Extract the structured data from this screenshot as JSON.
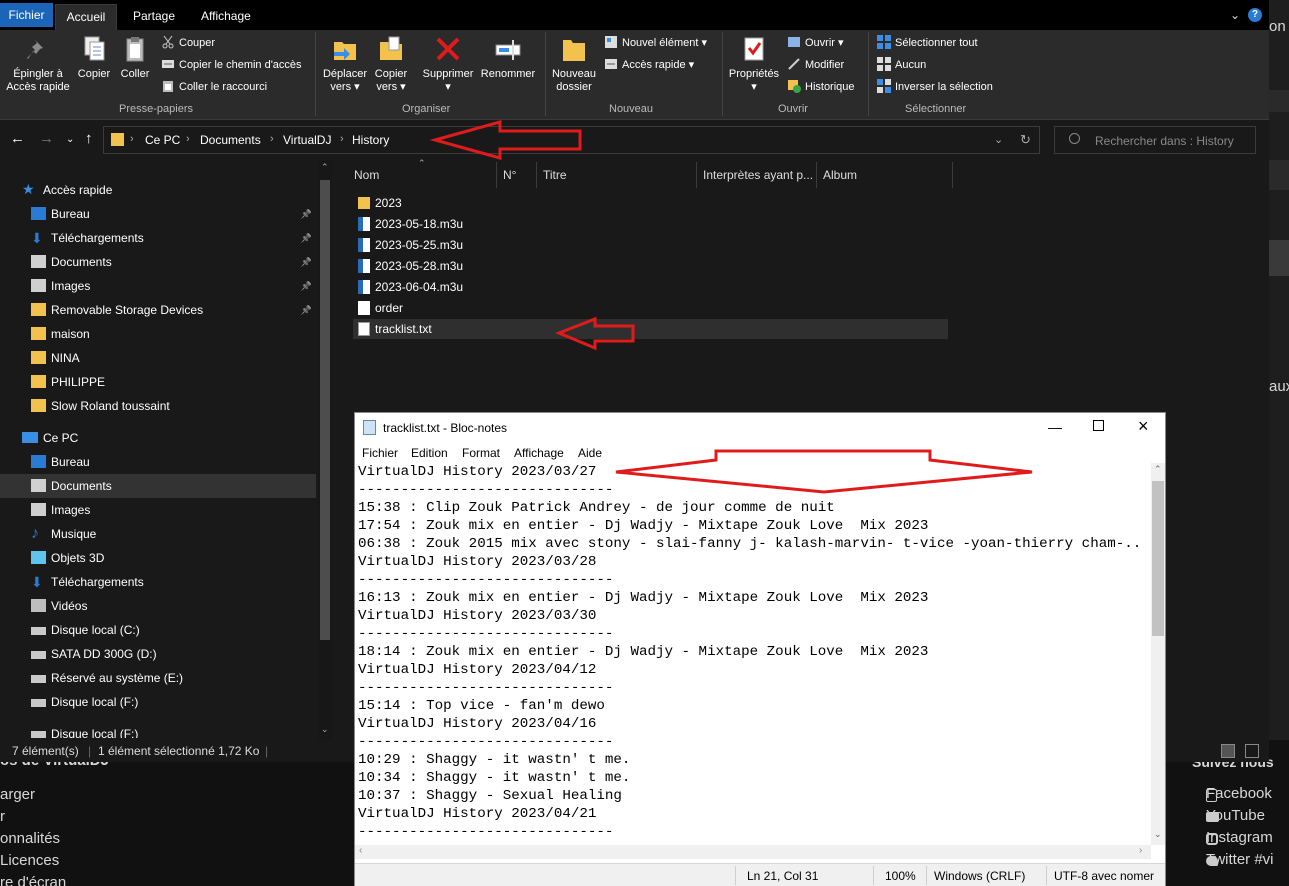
{
  "background": {
    "left_texts": [
      "os de VirtualDJ",
      "arger",
      "r",
      "onnalités",
      "Licences",
      "re d'écran"
    ],
    "right_header": "Suivez nous",
    "social": [
      "Facebook",
      "YouTube",
      "Instagram",
      "Twitter #vi"
    ],
    "edge_text_top": "on",
    "edge_text_mid": "aux"
  },
  "ribbon": {
    "tabs": [
      "Fichier",
      "Accueil",
      "Partage",
      "Affichage"
    ],
    "clipboard": {
      "pin_label_1": "Épingler à",
      "pin_label_2": "Accès rapide",
      "copy": "Copier",
      "paste": "Coller",
      "cut": "Couper",
      "copy_path": "Copier le chemin d'accès",
      "paste_shortcut": "Coller le raccourci",
      "group": "Presse-papiers"
    },
    "organize": {
      "move_1": "Déplacer",
      "move_2": "vers ▾",
      "copyto_1": "Copier",
      "copyto_2": "vers ▾",
      "delete_1": "Supprimer",
      "delete_2": "▾",
      "rename": "Renommer",
      "group": "Organiser"
    },
    "new": {
      "folder_1": "Nouveau",
      "folder_2": "dossier",
      "new_item": "Nouvel élément ▾",
      "easy_access": "Accès rapide ▾",
      "group": "Nouveau"
    },
    "open": {
      "props_1": "Propriétés",
      "props_2": "▾",
      "open": "Ouvrir ▾",
      "edit": "Modifier",
      "history": "Historique",
      "group": "Ouvrir"
    },
    "select": {
      "all": "Sélectionner tout",
      "none": "Aucun",
      "invert": "Inverser la sélection",
      "group": "Sélectionner"
    }
  },
  "address": {
    "crumbs": [
      "Ce PC",
      "Documents",
      "VirtualDJ",
      "History"
    ],
    "search_placeholder": "Rechercher dans : History"
  },
  "nav": {
    "quick_access": "Accès rapide",
    "quick_items": [
      "Bureau",
      "Téléchargements",
      "Documents",
      "Images",
      "Removable Storage Devices",
      "maison",
      "NINA",
      "PHILIPPE",
      "Slow Roland toussaint"
    ],
    "this_pc": "Ce PC",
    "pc_items": [
      "Bureau",
      "Documents",
      "Images",
      "Musique",
      "Objets 3D",
      "Téléchargements",
      "Vidéos",
      "Disque local (C:)",
      "SATA DD 300G (D:)",
      "Réservé au système (E:)",
      "Disque local (F:)",
      "Disque local (F:)"
    ]
  },
  "columns": [
    "Nom",
    "N°",
    "Titre",
    "Interprètes ayant p...",
    "Album"
  ],
  "files": [
    {
      "name": "2023",
      "type": "folder"
    },
    {
      "name": "2023-05-18.m3u",
      "type": "m3u"
    },
    {
      "name": "2023-05-25.m3u",
      "type": "m3u"
    },
    {
      "name": "2023-05-28.m3u",
      "type": "m3u"
    },
    {
      "name": "2023-06-04.m3u",
      "type": "m3u"
    },
    {
      "name": "order",
      "type": "file"
    },
    {
      "name": "tracklist.txt",
      "type": "txt"
    }
  ],
  "status": {
    "count": "7 élément(s)",
    "selected": "1 élément sélectionné  1,72 Ko"
  },
  "notepad": {
    "title": "tracklist.txt - Bloc-notes",
    "menu": [
      "Fichier",
      "Edition",
      "Format",
      "Affichage",
      "Aide"
    ],
    "lines": [
      "VirtualDJ History 2023/03/27",
      "------------------------------",
      "15:38 : Clip Zouk Patrick Andrey - de jour comme de nuit",
      "17:54 : Zouk mix en entier - Dj Wadjy - Mixtape Zouk Love  Mix 2023",
      "06:38 : Zouk 2015 mix avec stony - slai-fanny j- kalash-marvin- t-vice -yoan-thierry cham-..",
      "VirtualDJ History 2023/03/28",
      "------------------------------",
      "16:13 : Zouk mix en entier - Dj Wadjy - Mixtape Zouk Love  Mix 2023",
      "VirtualDJ History 2023/03/30",
      "------------------------------",
      "18:14 : Zouk mix en entier - Dj Wadjy - Mixtape Zouk Love  Mix 2023",
      "VirtualDJ History 2023/04/12",
      "------------------------------",
      "15:14 : Top vice - fan'm dewo",
      "VirtualDJ History 2023/04/16",
      "------------------------------",
      "10:29 : Shaggy - it wastn' t me.",
      "10:34 : Shaggy - it wastn' t me.",
      "10:37 : Shaggy - Sexual Healing",
      "VirtualDJ History 2023/04/21",
      "------------------------------"
    ],
    "status": {
      "position": "Ln 21, Col 31",
      "zoom": "100%",
      "eol": "Windows (CRLF)",
      "encoding": "UTF-8 avec nomer"
    }
  },
  "colors": {
    "accent": "#1a65b8",
    "folder": "#f2c14e",
    "arrow": "#e01b1b"
  }
}
